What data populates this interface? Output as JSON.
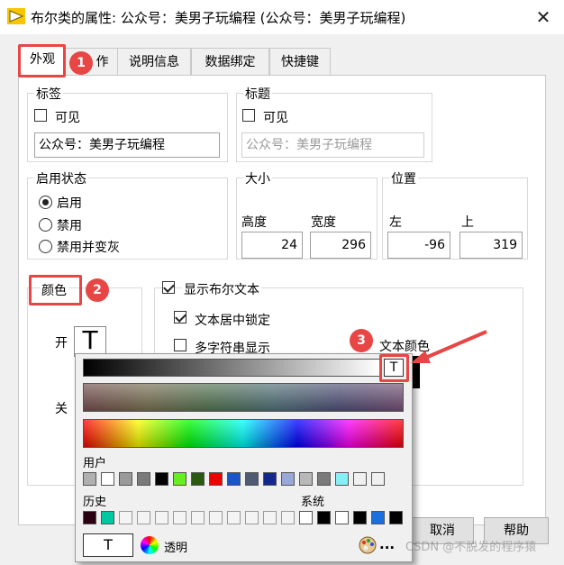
{
  "window": {
    "title": "布尔类的属性: 公众号：美男子玩编程 (公众号：美男子玩编程)",
    "close_glyph": "✕"
  },
  "tabs": [
    {
      "label": "外观"
    },
    {
      "label": "作"
    },
    {
      "label": "说明信息"
    },
    {
      "label": "数据绑定"
    },
    {
      "label": "快捷键"
    }
  ],
  "annotations": [
    "1",
    "2",
    "3"
  ],
  "label_group": {
    "title": "标签",
    "visible_label": "可见",
    "visible_checked": false,
    "value": "公众号：美男子玩编程"
  },
  "caption_group": {
    "title": "标题",
    "visible_label": "可见",
    "visible_checked": false,
    "placeholder": "公众号：美男子玩编程"
  },
  "enable_state": {
    "title": "启用状态",
    "options": [
      "启用",
      "禁用",
      "禁用并变灰"
    ],
    "selected": 0
  },
  "size": {
    "title": "大小",
    "height_label": "高度",
    "width_label": "宽度",
    "height": "24",
    "width": "296"
  },
  "position": {
    "title": "位置",
    "left_label": "左",
    "top_label": "上",
    "left": "-96",
    "top": "319"
  },
  "colors": {
    "title": "颜色",
    "on_label": "开",
    "off_label": "关",
    "transparent_glyph": "T"
  },
  "bool_text": {
    "show_label": "显示布尔文本",
    "show_checked": true,
    "lock_center_label": "文本居中锁定",
    "lock_center_checked": true,
    "multi_string_label": "多字符串显示",
    "multi_string_checked": false,
    "text_color_label": "文本颜色"
  },
  "picker": {
    "user_label": "用户",
    "history_label": "历史",
    "system_label": "系统",
    "transparent_label": "透明",
    "transparent_glyph": "T",
    "more_glyph": "...",
    "user_colors": [
      "#b0b0b0",
      "#ffffff",
      "#9a9a9a",
      "#7a7a7a",
      "#000000",
      "#66ee22",
      "#2a5a10",
      "#ee0000",
      "#1a55c8",
      "#505a72",
      "#14288c",
      "#9aa8d8",
      "#b8b8b8",
      "#7a7a7a",
      "#88eef8",
      "#f0f0f0",
      "#f0f0f0"
    ],
    "history_colors": [
      "#2a0010",
      "#00c8a0",
      "",
      "",
      "",
      "",
      "",
      "",
      "",
      "",
      "",
      ""
    ],
    "system_colors": [
      "#ffffff",
      "#000000",
      "#ffffff",
      "#000000",
      "#1a6ee0",
      "#000000"
    ]
  },
  "buttons": {
    "cancel": "取消",
    "help": "帮助"
  },
  "watermark": "CSDN @不脱发的程序猿"
}
